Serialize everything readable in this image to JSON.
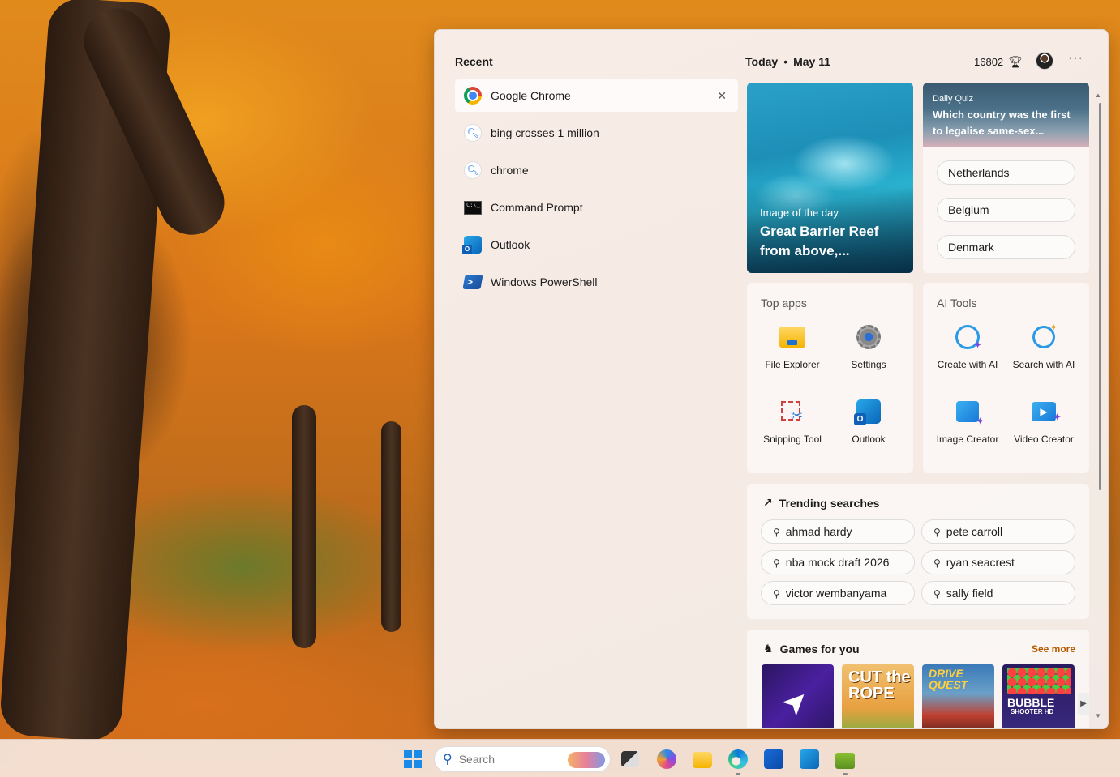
{
  "recent": {
    "title": "Recent",
    "items": [
      {
        "label": "Google Chrome",
        "icon": "chrome-icon"
      },
      {
        "label": "bing crosses 1 million",
        "icon": "search-icon"
      },
      {
        "label": "chrome",
        "icon": "search-icon"
      },
      {
        "label": "Command Prompt",
        "icon": "command-prompt-icon"
      },
      {
        "label": "Outlook",
        "icon": "outlook-icon"
      },
      {
        "label": "Windows PowerShell",
        "icon": "powershell-icon"
      }
    ]
  },
  "header": {
    "today": "Today",
    "date": "May 11",
    "points": "16802",
    "more": "···"
  },
  "image_of_day": {
    "label": "Image of the day",
    "title": "Great Barrier Reef from above,..."
  },
  "quiz": {
    "label": "Daily Quiz",
    "question": "Which country was the first to legalise same-sex...",
    "options": [
      "Netherlands",
      "Belgium",
      "Denmark"
    ]
  },
  "top_apps": {
    "title": "Top apps",
    "apps": [
      "File Explorer",
      "Settings",
      "Snipping Tool",
      "Outlook"
    ]
  },
  "ai_tools": {
    "title": "AI Tools",
    "tools": [
      "Create with AI",
      "Search with AI",
      "Image Creator",
      "Video Creator"
    ]
  },
  "trending": {
    "title": "Trending searches",
    "items": [
      "ahmad hardy",
      "pete carroll",
      "nba mock draft 2026",
      "ryan seacrest",
      "victor wembanyama",
      "sally field"
    ]
  },
  "games": {
    "title": "Games for you",
    "see_more": "See more",
    "tiles": [
      {
        "text": ""
      },
      {
        "text": "CUT the ROPE"
      },
      {
        "text": "DRIVE QUEST"
      },
      {
        "text": "BUBBLE",
        "sub": "SHOOTER HD"
      }
    ]
  },
  "taskbar": {
    "search_placeholder": "Search"
  }
}
